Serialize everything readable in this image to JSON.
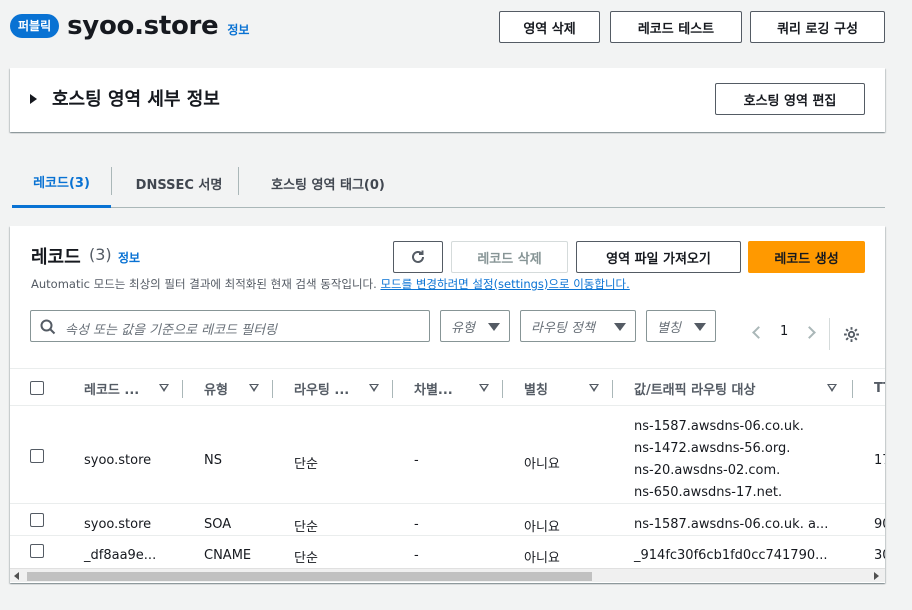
{
  "header": {
    "badge": "퍼블릭",
    "title": "syoo.store",
    "info": "정보",
    "buttons": [
      "영역 삭제",
      "레코드 테스트",
      "쿼리 로깅 구성"
    ]
  },
  "details": {
    "title": "호스팅 영역 세부 정보",
    "edit_button": "호스팅 영역 편집"
  },
  "tabs": [
    "레코드(3)",
    "DNSSEC 서명",
    "호스팅 영역 태그(0)"
  ],
  "records": {
    "title": "레코드",
    "count": "(3)",
    "info": "정보",
    "description": "Automatic 모드는 최상의 필터 결과에 최적화된 현재 검색 동작입니다.",
    "description_link": "모드를 변경하려면 설정(settings)으로 이동합니다.",
    "buttons": {
      "delete": "레코드 삭제",
      "import": "영역 파일 가져오기",
      "create": "레코드 생성"
    },
    "search_placeholder": "속성 또는 값을 기준으로 레코드 필터링",
    "filters": [
      "유형",
      "라우팅 정책",
      "별칭"
    ],
    "page": "1",
    "columns": [
      "레코드 ...",
      "유형",
      "라우팅 ...",
      "차별...",
      "별칭",
      "값/트래픽 라우팅 대상",
      "TT"
    ],
    "rows": [
      {
        "name": "syoo.store",
        "type": "NS",
        "routing": "단순",
        "diff": "-",
        "alias": "아니요",
        "values": [
          "ns-1587.awsdns-06.co.uk.",
          "ns-1472.awsdns-56.org.",
          "ns-20.awsdns-02.com.",
          "ns-650.awsdns-17.net."
        ],
        "ttl": "17"
      },
      {
        "name": "syoo.store",
        "type": "SOA",
        "routing": "단순",
        "diff": "-",
        "alias": "아니요",
        "values": [
          "ns-1587.awsdns-06.co.uk. a..."
        ],
        "ttl": "90"
      },
      {
        "name": "_df8aa9e...",
        "type": "CNAME",
        "routing": "단순",
        "diff": "-",
        "alias": "아니요",
        "values": [
          "_914fc30f6cb1fd0cc741790..."
        ],
        "ttl": "30"
      }
    ]
  },
  "colors": {
    "accent": "#0972d3",
    "primary_button": "#ff9900"
  }
}
